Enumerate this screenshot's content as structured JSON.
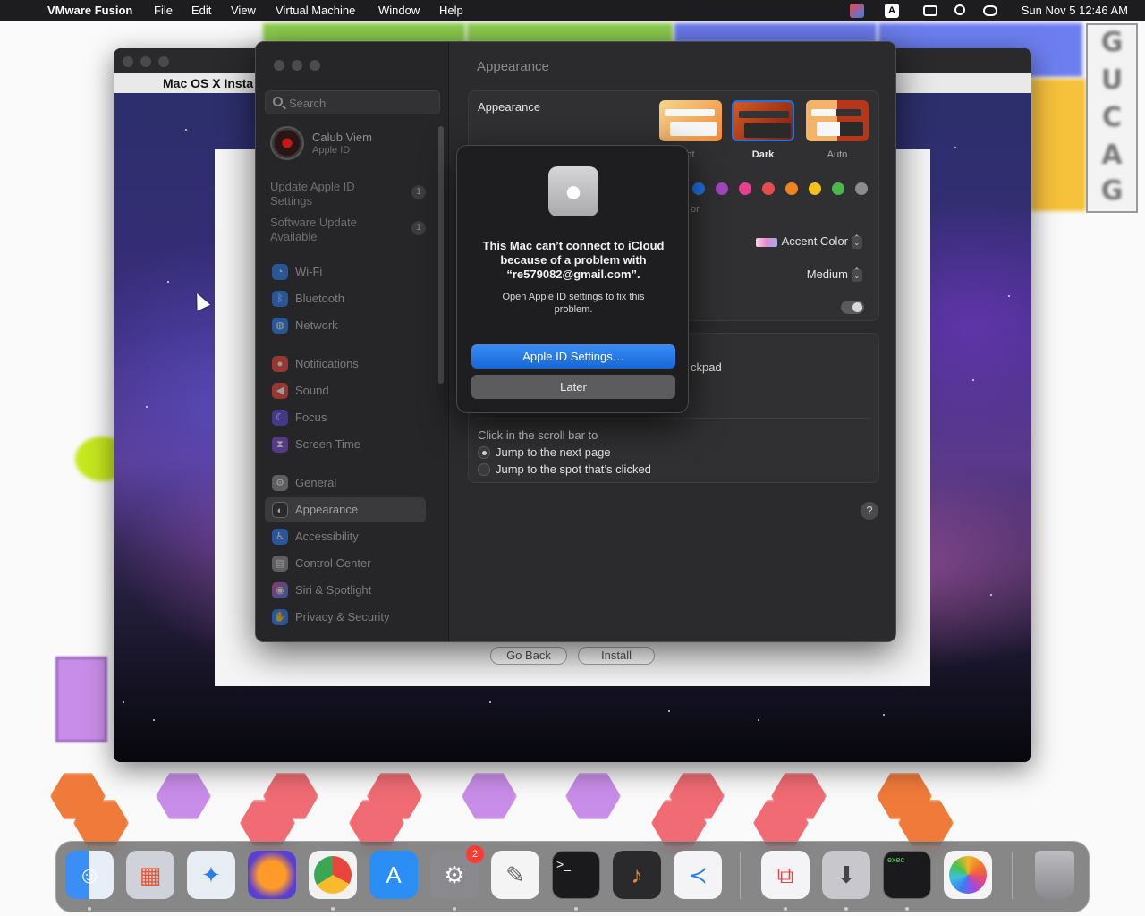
{
  "menubar": {
    "app": "VMware Fusion",
    "items": [
      "File",
      "Edit",
      "View",
      "Virtual Machine",
      "Window",
      "Help"
    ],
    "status_icons": [
      "vmware-status-icon",
      "input-source-icon",
      "screen-mirroring-icon",
      "search-icon",
      "control-center-icon"
    ],
    "input_source": "A",
    "clock": "Sun Nov 5  12:46 AM"
  },
  "vm": {
    "guest_menu_title": "Mac OS X Insta",
    "installer": {
      "back": "Go Back",
      "install": "Install"
    }
  },
  "sidebar": {
    "search_placeholder": "Search",
    "account": {
      "name": "Calub Viem",
      "sub": "Apple ID"
    },
    "notices": [
      {
        "text": "Update Apple ID Settings",
        "badge": "1"
      },
      {
        "text": "Software Update Available",
        "badge": "1"
      }
    ],
    "items": [
      {
        "label": "Wi-Fi",
        "icon": "wifi-icon",
        "color": "#2a7ef0"
      },
      {
        "label": "Bluetooth",
        "icon": "bluetooth-icon",
        "color": "#2a7ef0"
      },
      {
        "label": "Network",
        "icon": "globe-icon",
        "color": "#2a7ef0"
      },
      {
        "label": "Notifications",
        "icon": "bell-icon",
        "color": "#f0463b"
      },
      {
        "label": "Sound",
        "icon": "speaker-icon",
        "color": "#f0463b"
      },
      {
        "label": "Focus",
        "icon": "moon-icon",
        "color": "#5a4bd8"
      },
      {
        "label": "Screen Time",
        "icon": "hourglass-icon",
        "color": "#7a4bd8"
      },
      {
        "label": "General",
        "icon": "gear-icon",
        "color": "#8e8e92"
      },
      {
        "label": "Appearance",
        "icon": "appearance-icon",
        "color": "#1c1c1e"
      },
      {
        "label": "Accessibility",
        "icon": "accessibility-icon",
        "color": "#2a7ef0"
      },
      {
        "label": "Control Center",
        "icon": "control-center-icon",
        "color": "#8e8e92"
      },
      {
        "label": "Siri & Spotlight",
        "icon": "siri-icon",
        "color": "#8a3ae0"
      },
      {
        "label": "Privacy & Security",
        "icon": "hand-icon",
        "color": "#2a7ef0"
      }
    ],
    "selected": "Appearance"
  },
  "content": {
    "title": "Appearance",
    "appearance_label": "Appearance",
    "thumbs": [
      {
        "label": "ht"
      },
      {
        "label": "Dark"
      },
      {
        "label": "Auto"
      }
    ],
    "accent_partial": "or",
    "swatches": [
      "#1f6fe0",
      "#a347ba",
      "#e8418b",
      "#e64c4c",
      "#f0851f",
      "#f2c21b",
      "#4cb54a",
      "#8c8c8c"
    ],
    "highlight": {
      "value": "Accent Color"
    },
    "sidebar_icon_size": {
      "value": "Medium"
    },
    "scroll_partial": "ckpad",
    "scroll_click": {
      "label": "Click in the scroll bar to",
      "options": [
        "Jump to the next page",
        "Jump to the spot that’s clicked"
      ],
      "selected": 0
    }
  },
  "alert": {
    "title": "This Mac can’t connect to iCloud because of a problem with “re579082@gmail.com”.",
    "body": "Open Apple ID settings to fix this problem.",
    "primary": "Apple ID Settings…",
    "secondary": "Later"
  },
  "dock": {
    "apps": [
      {
        "name": "finder-icon",
        "color": "#3a8ef5"
      },
      {
        "name": "launchpad-icon",
        "color": "#cfd2d8"
      },
      {
        "name": "safari-icon",
        "color": "#e9eef5"
      },
      {
        "name": "firefox-icon",
        "color": "#5b3fd0"
      },
      {
        "name": "chrome-icon",
        "color": "#f2f2f2"
      },
      {
        "name": "app-store-icon",
        "color": "#2a8ef5"
      },
      {
        "name": "system-settings-icon",
        "color": "#8a8a8e",
        "badge": "2"
      },
      {
        "name": "textedit-icon",
        "color": "#f4f4f4"
      },
      {
        "name": "terminal-icon",
        "color": "#1a1a1c"
      },
      {
        "name": "garageband-icon",
        "color": "#2a2a2c"
      },
      {
        "name": "vscode-icon",
        "color": "#f4f4f6"
      },
      {
        "name": "vmware-fusion-icon",
        "color": "#f4f4f6"
      },
      {
        "name": "installer-icon",
        "color": "#c8c8cc"
      },
      {
        "name": "exec-icon",
        "color": "#1a1a1c"
      },
      {
        "name": "photos-icon",
        "color": "#f4f4f6"
      },
      {
        "name": "trash-icon",
        "color": "#9a9a9e"
      }
    ],
    "exec_label": "exec"
  }
}
